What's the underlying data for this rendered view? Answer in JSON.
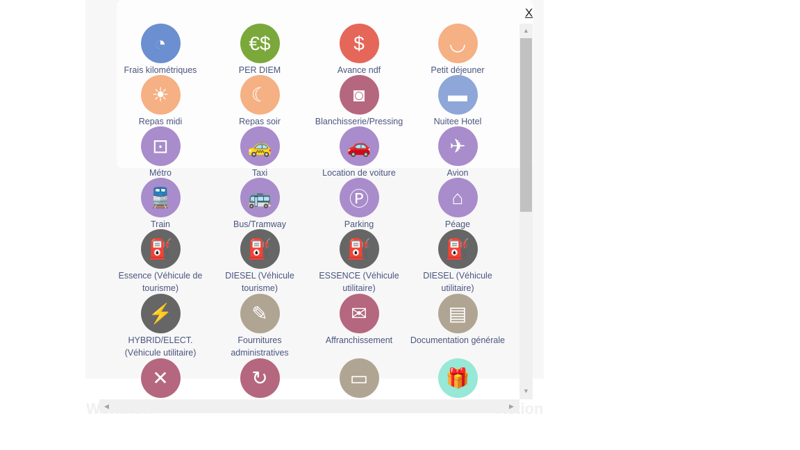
{
  "close_label": "X",
  "background": {
    "left_heading": "Workflow",
    "right_heading": "Action"
  },
  "items": [
    {
      "label": "Frais kilométriques",
      "icon": "speedometer-icon",
      "glyph": "◔",
      "color": "#6b8fd0"
    },
    {
      "label": "PER DIEM",
      "icon": "currency-bag-icon",
      "glyph": "€$",
      "color": "#7aa83a"
    },
    {
      "label": "Avance ndf",
      "icon": "money-stack-icon",
      "glyph": "$",
      "color": "#e5675a"
    },
    {
      "label": "Petit déjeuner",
      "icon": "bowl-icon",
      "glyph": "◡",
      "color": "#f5b084"
    },
    {
      "label": "Repas midi",
      "icon": "fork-knife-sun-icon",
      "glyph": "☀",
      "color": "#f5b084"
    },
    {
      "label": "Repas soir",
      "icon": "fork-knife-moon-icon",
      "glyph": "☾",
      "color": "#f5b084"
    },
    {
      "label": "Blanchisserie/Pressing",
      "icon": "washing-machine-icon",
      "glyph": "◙",
      "color": "#b5677f"
    },
    {
      "label": "Nuitee Hotel",
      "icon": "bed-icon",
      "glyph": "▬",
      "color": "#8ea6d8"
    },
    {
      "label": "Métro",
      "icon": "metro-icon",
      "glyph": "⊡",
      "color": "#a98ccb"
    },
    {
      "label": "Taxi",
      "icon": "taxi-icon",
      "glyph": "🚕",
      "color": "#a98ccb"
    },
    {
      "label": "Location de voiture",
      "icon": "car-icon",
      "glyph": "🚗",
      "color": "#a98ccb"
    },
    {
      "label": "Avion",
      "icon": "airplane-icon",
      "glyph": "✈",
      "color": "#a98ccb"
    },
    {
      "label": "Train",
      "icon": "train-icon",
      "glyph": "🚆",
      "color": "#a98ccb"
    },
    {
      "label": "Bus/Tramway",
      "icon": "bus-icon",
      "glyph": "🚌",
      "color": "#a98ccb"
    },
    {
      "label": "Parking",
      "icon": "parking-icon",
      "glyph": "Ⓟ",
      "color": "#a98ccb"
    },
    {
      "label": "Péage",
      "icon": "toll-booth-icon",
      "glyph": "⌂",
      "color": "#a98ccb"
    },
    {
      "label": "Essence (Véhicule de tourisme)",
      "icon": "fuel-nozzle-icon",
      "glyph": "⛽",
      "color": "#666666"
    },
    {
      "label": "DIESEL (Véhicule tourisme)",
      "icon": "fuel-nozzle-icon",
      "glyph": "⛽",
      "color": "#666666"
    },
    {
      "label": "ESSENCE (Véhicule utilitaire)",
      "icon": "fuel-nozzle-icon",
      "glyph": "⛽",
      "color": "#666666"
    },
    {
      "label": "DIESEL (Véhicule utilitaire)",
      "icon": "fuel-nozzle-icon",
      "glyph": "⛽",
      "color": "#666666"
    },
    {
      "label": "HYBRID/ELECT. (Véhicule utilitaire)",
      "icon": "electric-plug-icon",
      "glyph": "⚡",
      "color": "#666666"
    },
    {
      "label": "Fournitures administratives",
      "icon": "pen-icon",
      "glyph": "✎",
      "color": "#b0a593"
    },
    {
      "label": "Affranchissement",
      "icon": "envelope-icon",
      "glyph": "✉",
      "color": "#b5677f"
    },
    {
      "label": "Documentation générale",
      "icon": "documents-icon",
      "glyph": "▤",
      "color": "#b0a593"
    },
    {
      "label": "",
      "icon": "tools-icon",
      "glyph": "✕",
      "color": "#b5677f"
    },
    {
      "label": "",
      "icon": "calendar-cycle-icon",
      "glyph": "↻",
      "color": "#b5677f"
    },
    {
      "label": "",
      "icon": "computer-monitor-icon",
      "glyph": "▭",
      "color": "#b0a593"
    },
    {
      "label": "",
      "icon": "gift-icon",
      "glyph": "🎁",
      "color": "#97e8d6"
    }
  ]
}
